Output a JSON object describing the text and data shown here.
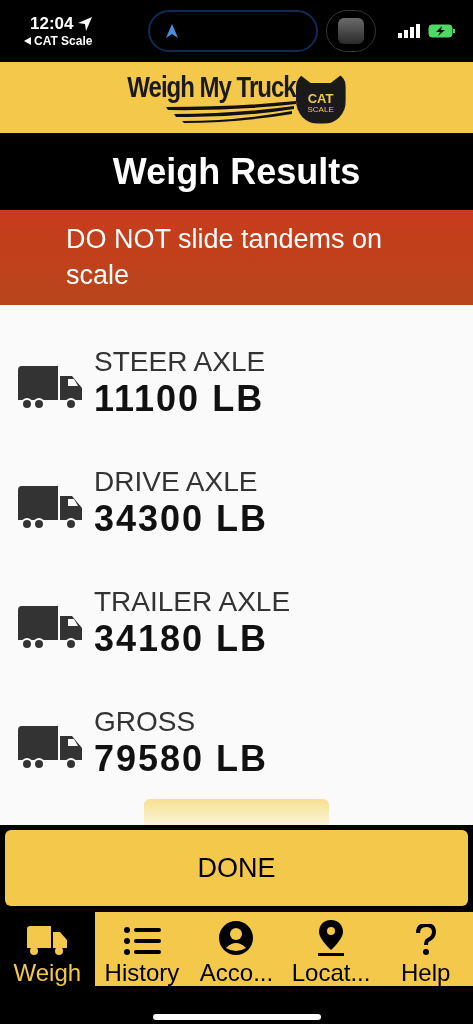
{
  "status_bar": {
    "time": "12:04",
    "back_label": "CAT Scale"
  },
  "logo": {
    "title": "Weigh My Truck",
    "badge": "CAT",
    "badge_sub": "SCALE"
  },
  "header": {
    "title": "Weigh Results"
  },
  "alert": {
    "text": "DO NOT slide tandems on scale"
  },
  "results": [
    {
      "label": "STEER AXLE",
      "value": "11100 LB"
    },
    {
      "label": "DRIVE AXLE",
      "value": "34300 LB"
    },
    {
      "label": "TRAILER AXLE",
      "value": "34180 LB"
    },
    {
      "label": "GROSS",
      "value": "79580 LB"
    }
  ],
  "done_button": {
    "label": "DONE"
  },
  "tabs": [
    {
      "kind": "truck",
      "label": "Weigh",
      "selected": true
    },
    {
      "kind": "list",
      "label": "History",
      "selected": false
    },
    {
      "kind": "account",
      "label": "Acco...",
      "selected": false
    },
    {
      "kind": "location",
      "label": "Locat...",
      "selected": false
    },
    {
      "kind": "help",
      "label": "Help",
      "selected": false
    }
  ]
}
